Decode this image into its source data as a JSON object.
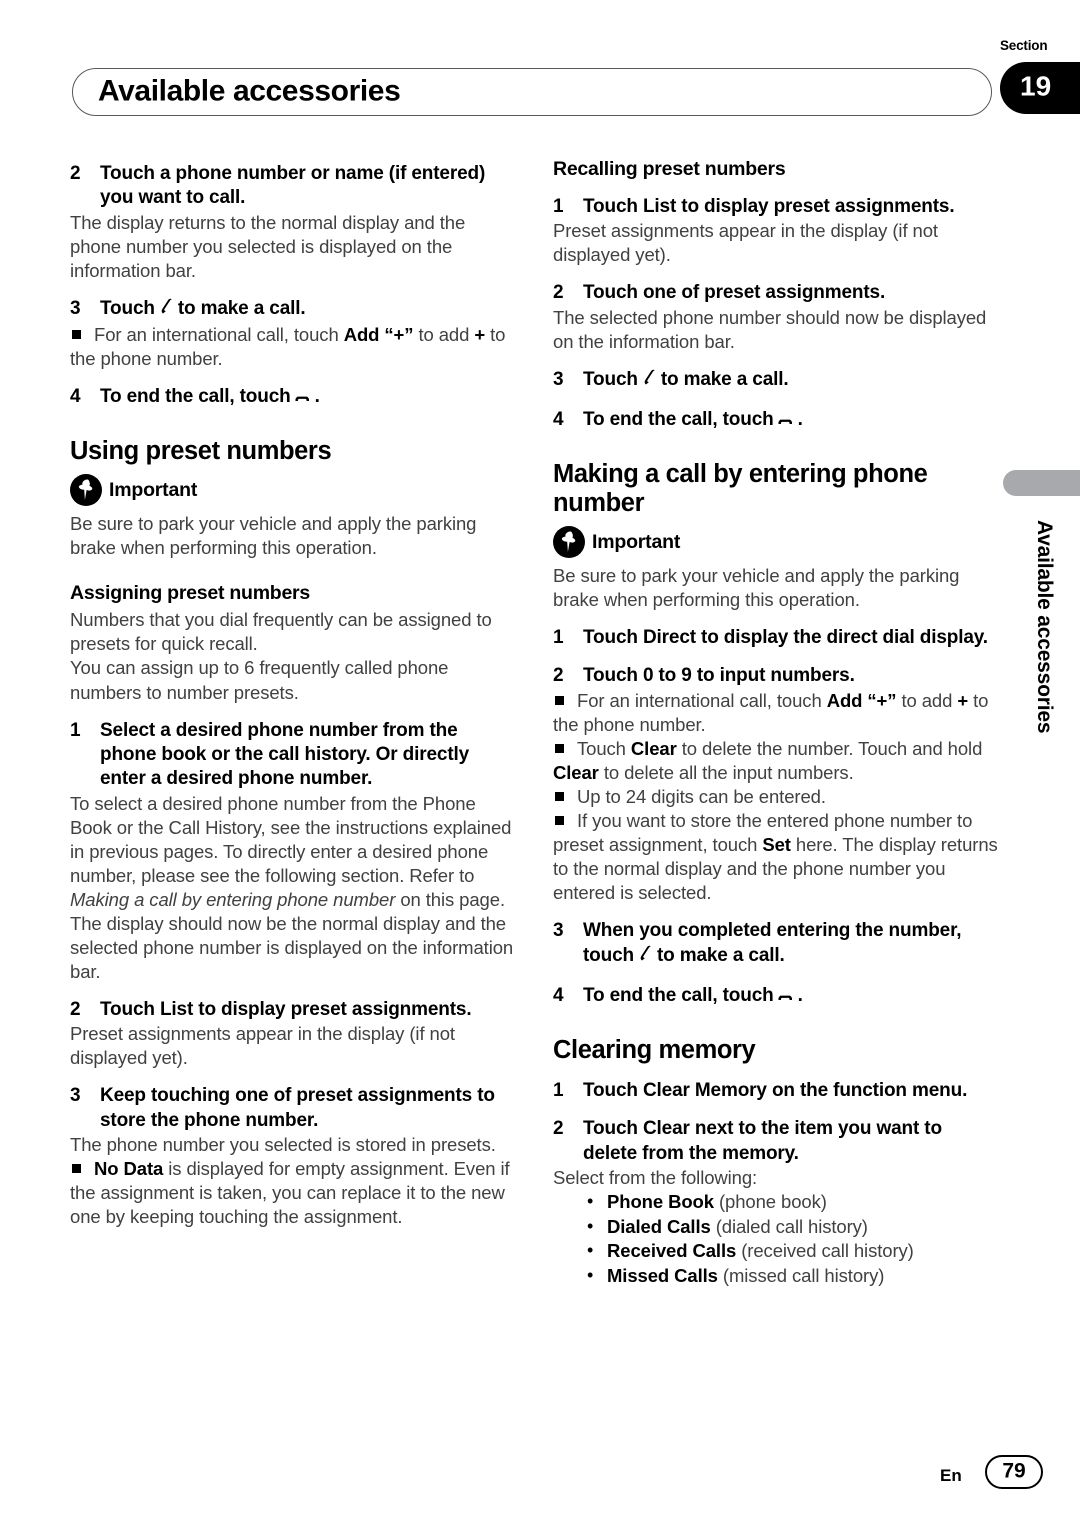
{
  "header": {
    "title": "Available accessories",
    "section_label": "Section",
    "section_number": "19"
  },
  "side_tab": {
    "text": "Available accessories"
  },
  "footer": {
    "language": "En",
    "page_number": "79"
  },
  "icons": {
    "important": "pushpin-icon",
    "make_call": "phone-handset-offhook-icon",
    "end_call": "phone-handset-onhook-icon",
    "bullet": "black-square-bullet"
  },
  "left_column": {
    "step_2": {
      "num": "2",
      "text": "Touch a phone number or name (if entered) you want to call."
    },
    "step_2_body": "The display returns to the normal display and the phone number you selected is displayed on the information bar.",
    "step_3": {
      "num": "3",
      "text_before": "Touch",
      "text_after": "to make a call."
    },
    "step_3_note": {
      "part1": "For an international call, touch ",
      "bold1": "Add “+”",
      "part2": " to add ",
      "bold2": "+",
      "part3": " to the phone number."
    },
    "step_4": {
      "num": "4",
      "text_before": "To end the call, touch",
      "text_after": "."
    },
    "heading_using_preset": "Using preset numbers",
    "important_label": "Important",
    "important_body": "Be sure to park your vehicle and apply the parking brake when performing this operation.",
    "heading_assigning": "Assigning preset numbers",
    "assigning_body_1": "Numbers that you dial frequently can be assigned to presets for quick recall.",
    "assigning_body_2": "You can assign up to 6 frequently called phone numbers to number presets.",
    "a_step_1": {
      "num": "1",
      "text": "Select a desired phone number from the phone book or the call history. Or directly enter a desired phone number."
    },
    "a_step_1_body_pre": "To select a desired phone number from the Phone Book or the Call History, see the instructions explained in previous pages. To directly enter a desired phone number, please see the following section. Refer to ",
    "a_step_1_body_italic": "Making a call by entering phone number",
    "a_step_1_body_post": " on this page.",
    "a_step_1_body_2": "The display should now be the normal display and the selected phone number is displayed on the information bar.",
    "a_step_2": {
      "num": "2",
      "text": "Touch List to display preset assignments."
    },
    "a_step_2_body": "Preset assignments appear in the display (if not displayed yet).",
    "a_step_3": {
      "num": "3",
      "text": "Keep touching one of preset assignments to store the phone number."
    },
    "a_step_3_body": "The phone number you selected is stored in presets.",
    "a_step_3_note": {
      "bold1": "No Data",
      "part1": " is displayed for empty assignment. Even if the assignment is taken, you can replace it to the new one by keeping touching the assignment."
    }
  },
  "right_column": {
    "heading_recalling": "Recalling preset numbers",
    "r_step_1": {
      "num": "1",
      "text": "Touch List to display preset assignments."
    },
    "r_step_1_body": "Preset assignments appear in the display (if not displayed yet).",
    "r_step_2": {
      "num": "2",
      "text": "Touch one of preset assignments."
    },
    "r_step_2_body": "The selected phone number should now be displayed on the information bar.",
    "r_step_3": {
      "num": "3",
      "text_before": "Touch",
      "text_after": "to make a call."
    },
    "r_step_4": {
      "num": "4",
      "text_before": "To end the call, touch",
      "text_after": "."
    },
    "heading_making_call": "Making a call by entering phone number",
    "important_label": "Important",
    "important_body": "Be sure to park your vehicle and apply the parking brake when performing this operation.",
    "m_step_1": {
      "num": "1",
      "text": "Touch Direct to display the direct dial display."
    },
    "m_step_2": {
      "num": "2",
      "text": "Touch 0 to 9 to input numbers."
    },
    "m_note_1": {
      "part1": "For an international call, touch ",
      "bold1": "Add “+”",
      "part2": " to add ",
      "bold2": "+",
      "part3": " to the phone number."
    },
    "m_note_2": {
      "part1": "Touch ",
      "bold1": "Clear",
      "part2": " to delete the number. Touch and hold ",
      "bold2": "Clear",
      "part3": " to delete all the input numbers."
    },
    "m_note_3": {
      "part1": "Up to 24 digits can be entered."
    },
    "m_note_4": {
      "part1": "If you want to store the entered phone number to preset assignment, touch ",
      "bold1": "Set",
      "part2": " here. The display returns to the normal display and the phone number you entered is selected."
    },
    "m_step_3": {
      "num": "3",
      "text_before": "When you completed entering the number, touch",
      "text_after": "to make a call."
    },
    "m_step_4": {
      "num": "4",
      "text_before": "To end the call, touch",
      "text_after": "."
    },
    "heading_clearing": "Clearing memory",
    "c_step_1": {
      "num": "1",
      "text": "Touch Clear Memory on the function menu."
    },
    "c_step_2": {
      "num": "2",
      "text": "Touch Clear next to the item you want to delete from the memory."
    },
    "c_step_2_body": "Select from the following:",
    "c_options": [
      {
        "bold": "Phone Book",
        "plain": " (phone book)"
      },
      {
        "bold": "Dialed Calls",
        "plain": " (dialed call history)"
      },
      {
        "bold": "Received Calls",
        "plain": " (received call history)"
      },
      {
        "bold": "Missed Calls",
        "plain": " (missed call history)"
      }
    ]
  }
}
